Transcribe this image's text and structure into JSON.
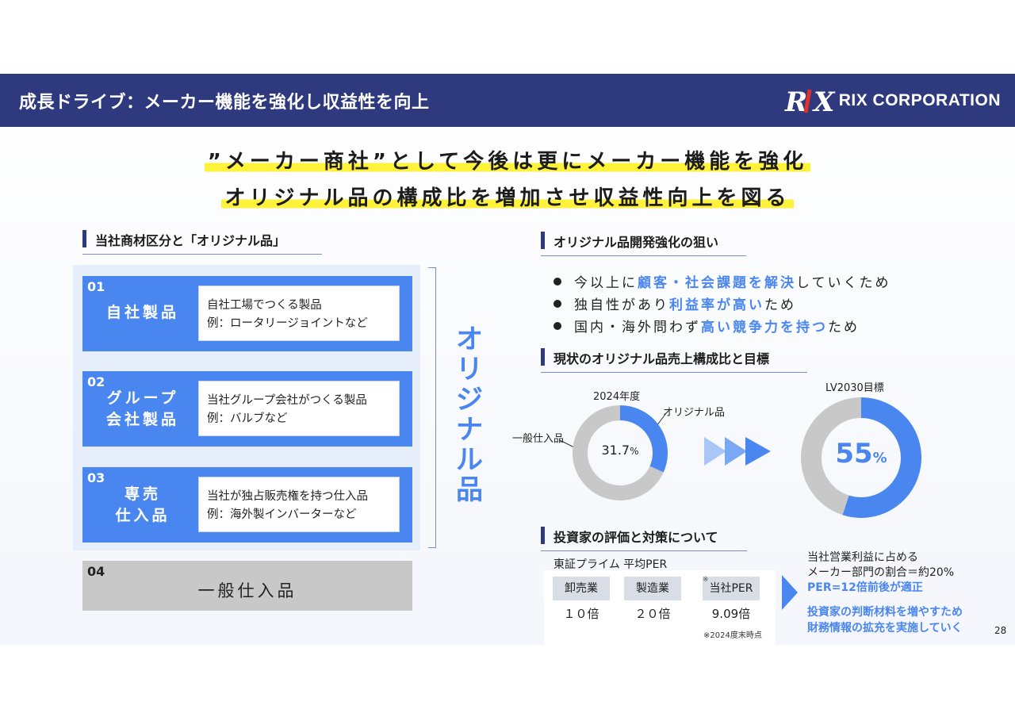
{
  "header": {
    "title": "成長ドライブ：メーカー機能を強化し収益性を向上",
    "logo_mark": "RIX",
    "logo_text": "RIX CORPORATION"
  },
  "headline": {
    "line1": "”メーカー商社”として今後は更にメーカー機能を強化",
    "line2": "オリジナル品の構成比を増加させ収益性向上を図る"
  },
  "left": {
    "section_title": "当社商材区分と「オリジナル品」",
    "categories": [
      {
        "num": "01",
        "name_lines": [
          "自社製品"
        ],
        "desc1": "自社工場でつくる製品",
        "desc2": "例：ロータリージョイントなど"
      },
      {
        "num": "02",
        "name_lines": [
          "グループ",
          "会社製品"
        ],
        "desc1": "当社グループ会社がつくる製品",
        "desc2": "例：バルブなど"
      },
      {
        "num": "03",
        "name_lines": [
          "専売",
          "仕入品"
        ],
        "desc1": "当社が独占販売権を持つ仕入品",
        "desc2": "例：海外製インバーターなど"
      }
    ],
    "general": {
      "num": "04",
      "name": "一般仕入品"
    },
    "vertical_label": "オリジナル品"
  },
  "aims": {
    "section_title": "オリジナル品開発強化の狙い",
    "bullets": [
      {
        "pre": "今以上に",
        "hl": "顧客・社会課題を解決",
        "post": "していくため"
      },
      {
        "pre": "独自性があり",
        "hl": "利益率が高い",
        "post": "ため"
      },
      {
        "pre": "国内・海外問わず",
        "hl": "高い競争力を持つ",
        "post": "ため"
      }
    ]
  },
  "ratio": {
    "section_title": "現状のオリジナル品売上構成比と目標",
    "current": {
      "label": "2024年度",
      "value": "31.7",
      "unit": "%",
      "original_label": "オリジナル品",
      "general_label": "一般仕入品"
    },
    "target": {
      "label": "LV2030目標",
      "value": "55",
      "unit": "%"
    }
  },
  "chart_data": [
    {
      "type": "pie",
      "title": "2024年度",
      "categories": [
        "オリジナル品",
        "一般仕入品"
      ],
      "values": [
        31.7,
        68.3
      ],
      "colors": [
        "#4a86f0",
        "#c8c8c8"
      ]
    },
    {
      "type": "pie",
      "title": "LV2030目標",
      "categories": [
        "オリジナル品",
        "一般仕入品"
      ],
      "values": [
        55,
        45
      ],
      "colors": [
        "#4a86f0",
        "#c8c8c8"
      ]
    }
  ],
  "investor": {
    "section_title": "投資家の評価と対策について",
    "caption": "東証プライム 平均PER",
    "columns": [
      {
        "label": "卸売業",
        "value": "１０倍"
      },
      {
        "label": "製造業",
        "value": "２０倍"
      },
      {
        "label": "当社PER",
        "value": "9.09倍",
        "mark": "※"
      }
    ],
    "note": "※2024度末時点",
    "right_line1": "当社営業利益に占める",
    "right_line2": "メーカー部門の割合＝約20%",
    "right_line3": "PER=12倍前後が適正",
    "right_line4": "投資家の判断材料を増やすため",
    "right_line5": "財務情報の拡充を実施していく"
  },
  "page_number": "28"
}
